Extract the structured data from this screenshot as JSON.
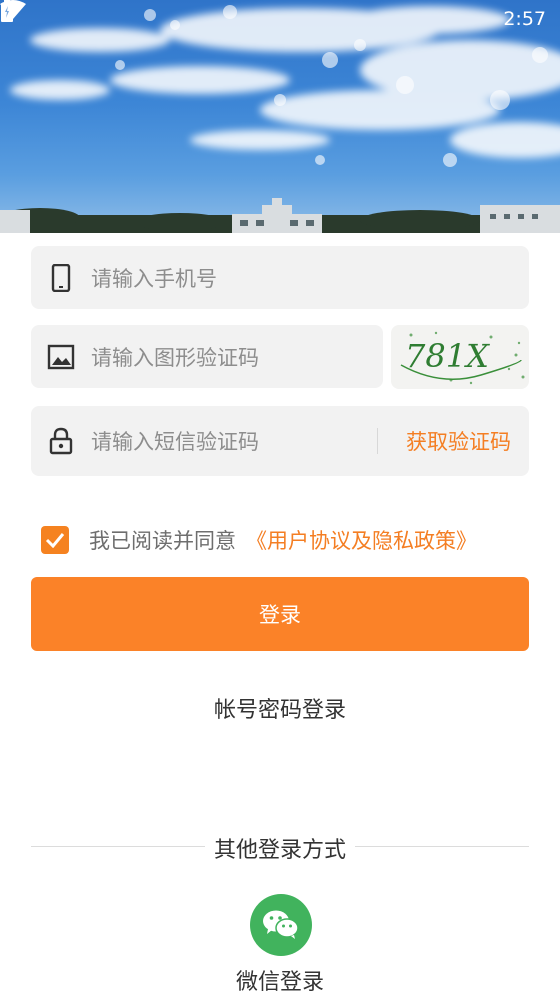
{
  "status_bar": {
    "time": "2:57",
    "icons": [
      "wifi-icon",
      "battery-icon"
    ]
  },
  "login_form": {
    "phone_placeholder": "请输入手机号",
    "captcha_placeholder": "请输入图形验证码",
    "captcha_text": "781X",
    "sms_placeholder": "请输入短信验证码",
    "get_code_label": "获取验证码"
  },
  "agreement": {
    "checked": true,
    "text": "我已阅读并同意",
    "link": "《用户协议及隐私政策》"
  },
  "actions": {
    "login_label": "登录",
    "account_login_label": "帐号密码登录"
  },
  "other_login": {
    "title": "其他登录方式",
    "wechat_label": "微信登录"
  },
  "colors": {
    "accent": "#fb8228",
    "link": "#f47e23",
    "wechat": "#41b35d",
    "field_bg": "#f2f2f2"
  }
}
